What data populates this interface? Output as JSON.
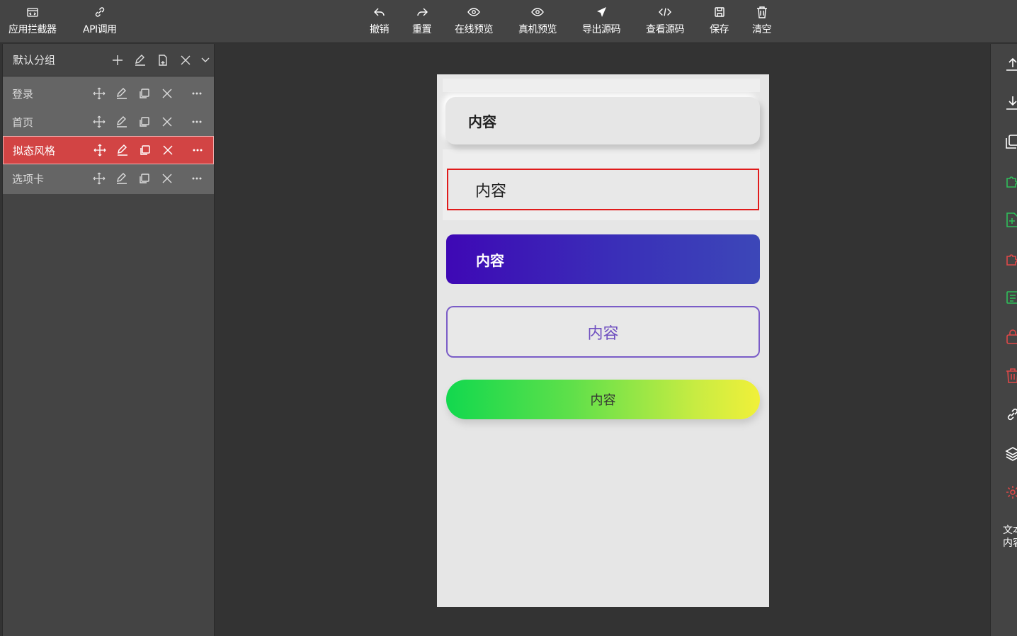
{
  "toolbar": {
    "left": [
      {
        "label": "应用拦截器",
        "icon": "intercept-icon"
      },
      {
        "label": "API调用",
        "icon": "link-icon"
      }
    ],
    "center": [
      {
        "label": "撤销",
        "icon": "undo-icon"
      },
      {
        "label": "重置",
        "icon": "redo-icon"
      },
      {
        "label": "在线预览",
        "icon": "eye-icon"
      },
      {
        "label": "真机预览",
        "icon": "eye-icon"
      },
      {
        "label": "导出源码",
        "icon": "send-icon"
      },
      {
        "label": "查看源码",
        "icon": "code-icon"
      },
      {
        "label": "保存",
        "icon": "save-icon"
      },
      {
        "label": "清空",
        "icon": "trash-icon"
      }
    ]
  },
  "sidebar": {
    "group_title": "默认分组",
    "pages": [
      {
        "name": "登录",
        "active": false
      },
      {
        "name": "首页",
        "active": false
      },
      {
        "name": "拟态风格",
        "active": true
      },
      {
        "name": "选项卡",
        "active": false
      }
    ]
  },
  "canvas": {
    "items": [
      {
        "type": "neumorphic-card",
        "text": "内容"
      },
      {
        "type": "selected-text",
        "text": "内容"
      },
      {
        "type": "gradient-purple-button",
        "text": "内容"
      },
      {
        "type": "outline-button",
        "text": "内容"
      },
      {
        "type": "gradient-pill-button",
        "text": "内容"
      }
    ]
  },
  "rightbar": {
    "icons": [
      "upload-icon",
      "download-icon",
      "copy-icon",
      "puzzle-add-icon",
      "file-add-icon",
      "puzzle-remove-icon",
      "list-icon",
      "lock-icon",
      "trash-icon",
      "link-icon",
      "layers-icon",
      "settings-icon"
    ],
    "text_line1": "文本",
    "text_line2": "内容"
  },
  "colors": {
    "active_page": "#d24444",
    "selection_border": "#e01b1b",
    "green_icon": "#2fbf5a",
    "red_icon": "#e04848"
  }
}
